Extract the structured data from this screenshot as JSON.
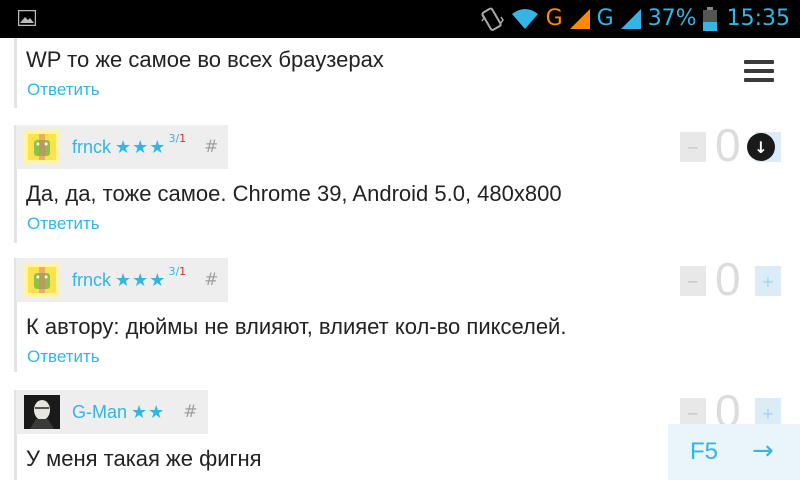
{
  "status_bar": {
    "network_1": "G",
    "network_2": "G",
    "battery_percent": "37%",
    "time": "15:35",
    "icons": [
      "gallery-icon",
      "vibrate-icon",
      "wifi-icon",
      "signal-icon",
      "battery-icon"
    ]
  },
  "comments": [
    {
      "text": "WP то же самое во всех браузерах",
      "reply_label": "Ответить"
    },
    {
      "author": "frnck",
      "stars": "★★★",
      "rating_a": "3",
      "rating_sep": "/",
      "rating_b": "1",
      "hash": "#",
      "text": "Да, да, тоже самое. Chrome 39, Android 5.0, 480x800",
      "reply_label": "Ответить",
      "vote_minus": "−",
      "vote_count": "0",
      "vote_plus": "+"
    },
    {
      "author": "frnck",
      "stars": "★★★",
      "rating_a": "3",
      "rating_sep": "/",
      "rating_b": "1",
      "hash": "#",
      "text": "К автору: дюймы не влияют, влияет кол-во пикселей.",
      "reply_label": "Ответить",
      "vote_minus": "−",
      "vote_count": "0",
      "vote_plus": "+"
    },
    {
      "author": "G-Man",
      "stars": "★★",
      "hash": "#",
      "text": "У меня такая же фигня",
      "vote_minus": "−",
      "vote_count": "0",
      "vote_plus": "+"
    }
  ],
  "controls": {
    "refresh_label": "F5",
    "next_arrow": "→",
    "scroll_down_glyph": "↓"
  },
  "colors": {
    "accent": "#33b5e5",
    "rating_red": "#d32f2f",
    "status_orange": "#ff8a00"
  }
}
